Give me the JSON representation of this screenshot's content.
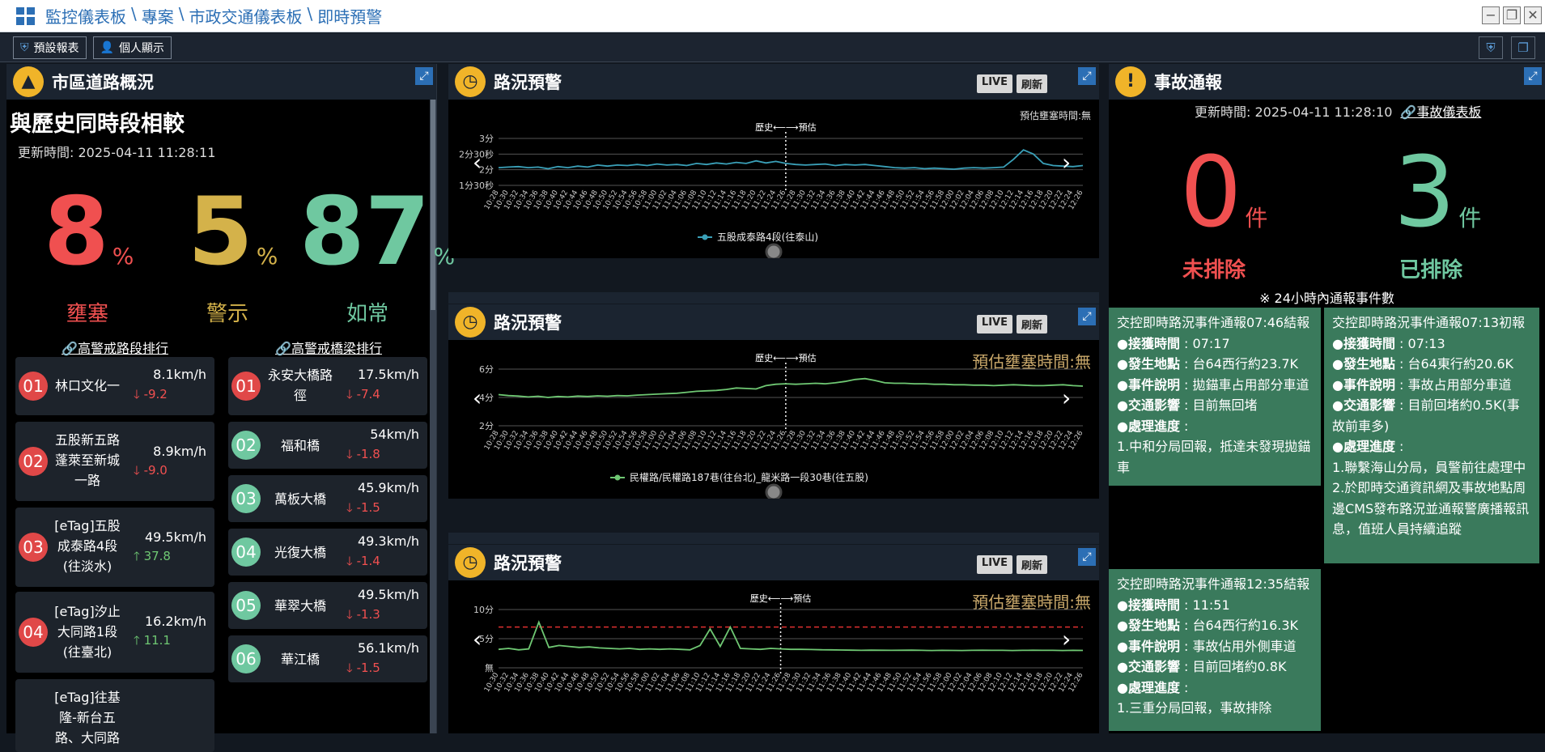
{
  "breadcrumb": [
    "監控儀表板",
    "專案",
    "市政交通儀表板",
    "即時預警"
  ],
  "breadcrumb_sep": "\\",
  "window_controls": {
    "min": "−",
    "max": "❐",
    "close": "✕"
  },
  "toolbar": {
    "preset_report": "預設報表",
    "personal_display": "個人顯示"
  },
  "road_panel": {
    "title": "市區道路概況",
    "compare_title": "與歷史同時段相較",
    "updated": "更新時間: 2025-04-11 11:28:11",
    "stats": [
      {
        "value": "8",
        "unit": "%",
        "label": "壅塞",
        "color": "#f05050"
      },
      {
        "value": "5",
        "unit": "%",
        "label": "警示",
        "color": "#d4b24a"
      },
      {
        "value": "87",
        "unit": "%",
        "label": "如常",
        "color": "#6fc8a0"
      }
    ],
    "road_rank_title": "🔗高警戒路段排行",
    "bridge_rank_title": "🔗高警戒橋梁排行",
    "roads": [
      {
        "rank": "01",
        "name": "林口文化一",
        "speed": "8.1km/h",
        "delta": "-9.2",
        "dir": "down"
      },
      {
        "rank": "02",
        "name": "五股新五路蓬萊至新城一路",
        "speed": "8.9km/h",
        "delta": "-9.0",
        "dir": "down"
      },
      {
        "rank": "03",
        "name": "[eTag]五股成泰路4段(往淡水)",
        "speed": "49.5km/h",
        "delta": "37.8",
        "dir": "up"
      },
      {
        "rank": "04",
        "name": "[eTag]汐止大同路1段(往臺北)",
        "speed": "16.2km/h",
        "delta": "11.1",
        "dir": "up"
      },
      {
        "rank": "",
        "name": "[eTag]往基隆-新台五路、大同路",
        "speed": "",
        "delta": "",
        "dir": ""
      }
    ],
    "bridges": [
      {
        "rank": "01",
        "name": "永安大橋路徑",
        "speed": "17.5km/h",
        "delta": "-7.4",
        "dir": "down"
      },
      {
        "rank": "02",
        "name": "福和橋",
        "speed": "54km/h",
        "delta": "-1.8",
        "dir": "down"
      },
      {
        "rank": "03",
        "name": "萬板大橋",
        "speed": "45.9km/h",
        "delta": "-1.5",
        "dir": "down"
      },
      {
        "rank": "04",
        "name": "光復大橋",
        "speed": "49.3km/h",
        "delta": "-1.4",
        "dir": "down"
      },
      {
        "rank": "05",
        "name": "華翠大橋",
        "speed": "49.5km/h",
        "delta": "-1.3",
        "dir": "down"
      },
      {
        "rank": "06",
        "name": "華江橋",
        "speed": "56.1km/h",
        "delta": "-1.5",
        "dir": "down"
      }
    ]
  },
  "chart_panels": [
    {
      "title": "路況預警",
      "live": "LIVE",
      "refresh": "刷新",
      "estimate": "預估壅塞時間:無",
      "split_label": "歷史⟵⟶預估",
      "legend": "五股成泰路4段(往泰山)"
    },
    {
      "title": "路況預警",
      "live": "LIVE",
      "refresh": "刷新",
      "estimate": "預估壅塞時間:無",
      "split_label": "歷史⟵⟶預估",
      "legend": "民權路/民權路187巷(往台北)_龍米路一段30巷(往五股)"
    },
    {
      "title": "路況預警",
      "live": "LIVE",
      "refresh": "刷新",
      "estimate": "預估壅塞時間:無",
      "split_label": "歷史⟵⟶預估",
      "legend": ""
    }
  ],
  "chart_data": [
    {
      "type": "line",
      "series": [
        {
          "name": "五股成泰路4段(往泰山)",
          "color": "#3aa0b8"
        }
      ],
      "y_ticks": [
        "3分",
        "2分30秒",
        "2分",
        "1分30秒"
      ],
      "ylim": [
        90,
        180
      ],
      "x": [
        "10:28",
        "10:30",
        "10:32",
        "10:34",
        "10:36",
        "10:38",
        "10:40",
        "10:42",
        "10:44",
        "10:46",
        "10:48",
        "10:50",
        "10:52",
        "10:54",
        "10:56",
        "10:58",
        "11:00",
        "11:02",
        "11:04",
        "11:06",
        "11:08",
        "11:10",
        "11:12",
        "11:14",
        "11:16",
        "11:18",
        "11:20",
        "11:22",
        "11:24",
        "11:26",
        "11:28",
        "11:30",
        "11:32",
        "11:34",
        "11:36",
        "11:38",
        "11:40",
        "11:42",
        "11:44",
        "11:46",
        "11:48",
        "11:50",
        "11:52",
        "11:54",
        "11:56",
        "11:58",
        "12:00",
        "12:02",
        "12:04",
        "12:06",
        "12:08",
        "12:10",
        "12:12",
        "12:14",
        "12:16",
        "12:18",
        "12:20",
        "12:22",
        "12:24",
        "12:26"
      ],
      "values": [
        124,
        125,
        126,
        124,
        125,
        122,
        126,
        124,
        127,
        125,
        129,
        127,
        129,
        128,
        130,
        128,
        131,
        129,
        130,
        128,
        132,
        130,
        133,
        131,
        134,
        132,
        137,
        133,
        136,
        132,
        130,
        129,
        130,
        131,
        128,
        130,
        129,
        130,
        128,
        126,
        124,
        123,
        124,
        122,
        123,
        122,
        121,
        123,
        124,
        123,
        124,
        125,
        140,
        158,
        150,
        132,
        128,
        127,
        126,
        128
      ],
      "split_index": 29
    },
    {
      "type": "line",
      "series": [
        {
          "name": "民權路/民權路187巷(往台北)_龍米路一段30巷(往五股)",
          "color": "#6fc873"
        }
      ],
      "y_ticks": [
        "6分",
        "4分",
        "2分"
      ],
      "ylim": [
        120,
        360
      ],
      "x": [
        "10:28",
        "10:30",
        "10:32",
        "10:34",
        "10:36",
        "10:38",
        "10:40",
        "10:42",
        "10:44",
        "10:46",
        "10:48",
        "10:50",
        "10:52",
        "10:54",
        "10:56",
        "10:58",
        "11:00",
        "11:02",
        "11:04",
        "11:06",
        "11:08",
        "11:10",
        "11:12",
        "11:14",
        "11:16",
        "11:18",
        "11:20",
        "11:22",
        "11:24",
        "11:26",
        "11:28",
        "11:30",
        "11:32",
        "11:34",
        "11:36",
        "11:38",
        "11:40",
        "11:42",
        "11:44",
        "11:46",
        "11:48",
        "11:50",
        "11:52",
        "11:54",
        "11:56",
        "11:58",
        "12:00",
        "12:02",
        "12:04",
        "12:06",
        "12:08",
        "12:10",
        "12:12",
        "12:14",
        "12:16",
        "12:18",
        "12:20",
        "12:22",
        "12:24",
        "12:26"
      ],
      "values": [
        252,
        248,
        246,
        242,
        245,
        240,
        244,
        242,
        246,
        244,
        247,
        245,
        248,
        247,
        250,
        252,
        254,
        256,
        258,
        262,
        266,
        268,
        270,
        274,
        280,
        278,
        276,
        290,
        296,
        298,
        296,
        298,
        300,
        298,
        302,
        308,
        316,
        320,
        312,
        302,
        300,
        300,
        298,
        298,
        296,
        296,
        294,
        294,
        292,
        292,
        290,
        292,
        294,
        292,
        290,
        290,
        292,
        294,
        290,
        288
      ],
      "split_index": 29
    },
    {
      "type": "line",
      "series": [
        {
          "name": "",
          "color": "#6fc873"
        }
      ],
      "y_ticks": [
        "10分",
        "5分",
        "無"
      ],
      "ylim": [
        0,
        600
      ],
      "threshold": {
        "value": 420,
        "color": "#e03030"
      },
      "x": [
        "10:30",
        "10:32",
        "10:34",
        "10:36",
        "10:38",
        "10:40",
        "10:42",
        "10:44",
        "10:46",
        "10:48",
        "10:50",
        "10:52",
        "10:54",
        "10:56",
        "10:58",
        "11:00",
        "11:02",
        "11:04",
        "11:06",
        "11:08",
        "11:10",
        "11:12",
        "11:14",
        "11:16",
        "11:18",
        "11:20",
        "11:22",
        "11:24",
        "11:26",
        "11:28",
        "11:30",
        "11:32",
        "11:34",
        "11:36",
        "11:38",
        "11:40",
        "11:42",
        "11:44",
        "11:46",
        "11:48",
        "11:50",
        "11:52",
        "11:54",
        "11:56",
        "11:58",
        "12:00",
        "12:02",
        "12:04",
        "12:06",
        "12:08",
        "12:10",
        "12:12",
        "12:14",
        "12:16",
        "12:18",
        "12:20",
        "12:22",
        "12:24",
        "12:26"
      ],
      "values": [
        190,
        200,
        185,
        195,
        470,
        210,
        230,
        220,
        210,
        215,
        205,
        200,
        195,
        200,
        190,
        195,
        190,
        195,
        190,
        185,
        230,
        400,
        220,
        420,
        200,
        195,
        190,
        200,
        195,
        190,
        190,
        188,
        186,
        185,
        183,
        182,
        180,
        182,
        181,
        180,
        181,
        182,
        180,
        178,
        180,
        179,
        178,
        180,
        181,
        180,
        180,
        178,
        180,
        181,
        180,
        180,
        178,
        180,
        179
      ],
      "split_index": 28
    }
  ],
  "incident_panel": {
    "title": "事故通報",
    "updated": "更新時間: 2025-04-11 11:28:10",
    "dashboard_link": "🔗事故儀表板",
    "unresolved": {
      "value": "0",
      "unit": "件",
      "label": "未排除",
      "color": "#f05050"
    },
    "resolved": {
      "value": "3",
      "unit": "件",
      "label": "已排除",
      "color": "#6fc8a0"
    },
    "note": "※ 24小時內通報事件數",
    "cards": [
      {
        "head": "交控即時路況事件通報07:46結報",
        "time_k": "●接獲時間",
        "time_v": " : 07:17",
        "loc_k": "●發生地點",
        "loc_v": " : 台64西行約23.7K",
        "desc_k": "●事件說明",
        "desc_v": " : 拋錨車占用部分車道",
        "imp_k": "●交通影響",
        "imp_v": " : 目前無回堵",
        "prog_k": "●處理進度",
        "prog_v": " :",
        "body": "1.中和分局回報，抵達未發現拋錨車"
      },
      {
        "head": "交控即時路況事件通報07:13初報",
        "time_k": "●接獲時間",
        "time_v": " : 07:13",
        "loc_k": "●發生地點",
        "loc_v": " : 台64東行約20.6K",
        "desc_k": "●事件說明",
        "desc_v": " : 事故占用部分車道",
        "imp_k": "●交通影響",
        "imp_v": " : 目前回堵約0.5K(事故前車多)",
        "prog_k": "●處理進度",
        "prog_v": " :",
        "body": "1.聯繫海山分局，員警前往處理中\n2.於即時交通資訊網及事故地點周邊CMS發布路況並通報警廣播報訊息，值班人員持續追蹤"
      },
      {
        "head": "交控即時路況事件通報12:35結報",
        "time_k": "●接獲時間",
        "time_v": " : 11:51",
        "loc_k": "●發生地點",
        "loc_v": " : 台64西行約16.3K",
        "desc_k": "●事件說明",
        "desc_v": " : 事故佔用外側車道",
        "imp_k": "●交通影響",
        "imp_v": " : 目前回堵約0.8K",
        "prog_k": "●處理進度",
        "prog_v": " :",
        "body": "1.三重分局回報，事故排除"
      }
    ]
  }
}
